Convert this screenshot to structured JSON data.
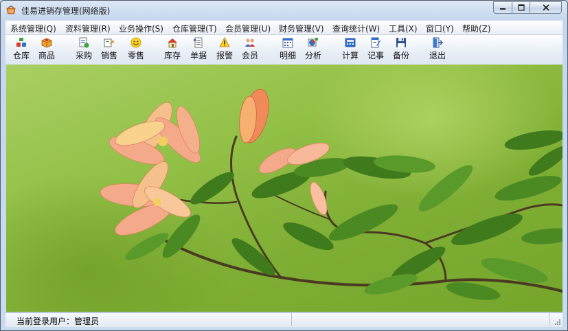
{
  "window": {
    "title": "佳易进销存管理(网络版)",
    "controls": {
      "minimize": "−",
      "maximize": "□",
      "close": "✕"
    }
  },
  "menu": [
    "系统管理(Q)",
    "资料管理(R)",
    "业务操作(S)",
    "仓库管理(T)",
    "会员管理(U)",
    "财务管理(V)",
    "查询统计(W)",
    "工具(X)",
    "窗口(Y)",
    "帮助(Z)"
  ],
  "toolbar": [
    {
      "label": "仓库",
      "icon": "warehouse-icon"
    },
    {
      "label": "商品",
      "icon": "goods-box-icon"
    },
    {
      "label": "采购",
      "icon": "purchase-icon"
    },
    {
      "label": "销售",
      "icon": "sales-icon"
    },
    {
      "label": "零售",
      "icon": "smiley-icon"
    },
    {
      "label": "库存",
      "icon": "house-icon"
    },
    {
      "label": "单据",
      "icon": "document-icon"
    },
    {
      "label": "报警",
      "icon": "warning-icon"
    },
    {
      "label": "会员",
      "icon": "members-icon"
    },
    {
      "label": "明细",
      "icon": "calendar-detail-icon"
    },
    {
      "label": "分析",
      "icon": "analysis-icon"
    },
    {
      "label": "计算",
      "icon": "calculator-icon"
    },
    {
      "label": "记事",
      "icon": "notebook-icon"
    },
    {
      "label": "备份",
      "icon": "save-disk-icon"
    },
    {
      "label": "退出",
      "icon": "exit-door-icon"
    }
  ],
  "status": {
    "user": "当前登录用户：管理员"
  },
  "colors": {
    "background_green": "#8cbc40",
    "flower_peach": "#f4a98a",
    "leaf_green": "#3f7a1c"
  }
}
